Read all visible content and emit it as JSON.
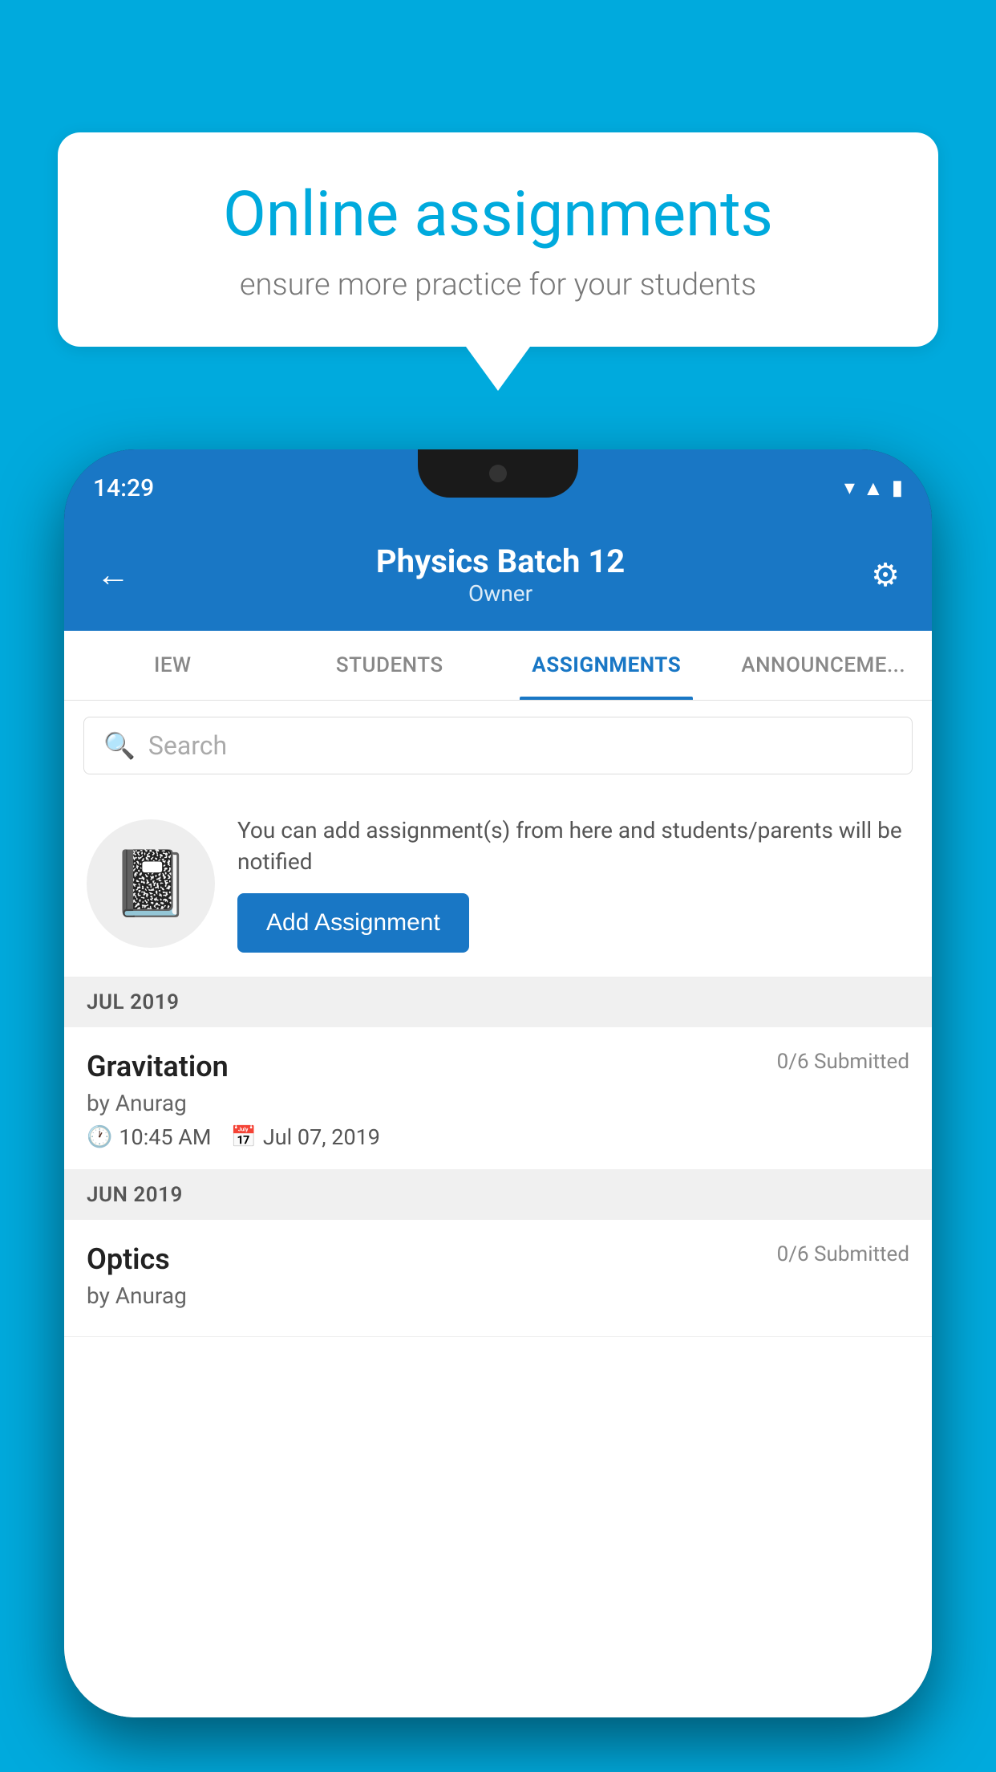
{
  "background": {
    "color": "#00AADD"
  },
  "speech_bubble": {
    "title": "Online assignments",
    "subtitle": "ensure more practice for your students"
  },
  "phone": {
    "status_bar": {
      "time": "14:29"
    },
    "header": {
      "title": "Physics Batch 12",
      "subtitle": "Owner",
      "back_label": "←",
      "settings_label": "⚙"
    },
    "tabs": [
      {
        "label": "IEW",
        "active": false
      },
      {
        "label": "STUDENTS",
        "active": false
      },
      {
        "label": "ASSIGNMENTS",
        "active": true
      },
      {
        "label": "ANNOUNCEMENTS",
        "active": false
      }
    ],
    "search": {
      "placeholder": "Search"
    },
    "promo": {
      "description": "You can add assignment(s) from here and students/parents will be notified",
      "add_button": "Add Assignment"
    },
    "sections": [
      {
        "header": "JUL 2019",
        "items": [
          {
            "name": "Gravitation",
            "submitted": "0/6 Submitted",
            "author": "by Anurag",
            "time": "10:45 AM",
            "date": "Jul 07, 2019"
          }
        ]
      },
      {
        "header": "JUN 2019",
        "items": [
          {
            "name": "Optics",
            "submitted": "0/6 Submitted",
            "author": "by Anurag",
            "time": "",
            "date": ""
          }
        ]
      }
    ]
  }
}
